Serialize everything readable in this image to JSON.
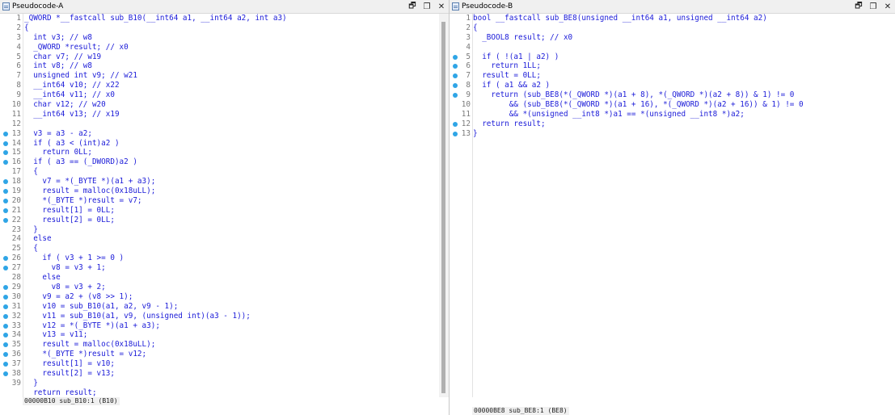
{
  "paneA": {
    "title": "Pseudocode-A",
    "controls": [
      "🗗",
      "🗖",
      "✕"
    ],
    "status": "00000B10 sub_B10:1 (B10)",
    "lines": [
      {
        "n": "1",
        "t": "_QWORD *__fastcall sub_B10(__int64 a1, __int64 a2, int a3)",
        "bp": false
      },
      {
        "n": "2",
        "t": "{",
        "bp": false
      },
      {
        "n": "3",
        "t": "  int v3; // w8",
        "bp": false
      },
      {
        "n": "4",
        "t": "  _QWORD *result; // x0",
        "bp": false
      },
      {
        "n": "5",
        "t": "  char v7; // w19",
        "bp": false
      },
      {
        "n": "6",
        "t": "  int v8; // w8",
        "bp": false
      },
      {
        "n": "7",
        "t": "  unsigned int v9; // w21",
        "bp": false
      },
      {
        "n": "8",
        "t": "  __int64 v10; // x22",
        "bp": false
      },
      {
        "n": "9",
        "t": "  __int64 v11; // x0",
        "bp": false
      },
      {
        "n": "10",
        "t": "  char v12; // w20",
        "bp": false
      },
      {
        "n": "11",
        "t": "  __int64 v13; // x19",
        "bp": false
      },
      {
        "n": "12",
        "t": "",
        "bp": false
      },
      {
        "n": "13",
        "t": "  v3 = a3 - a2;",
        "bp": true
      },
      {
        "n": "14",
        "t": "  if ( a3 < (int)a2 )",
        "bp": true
      },
      {
        "n": "15",
        "t": "    return 0LL;",
        "bp": true
      },
      {
        "n": "16",
        "t": "  if ( a3 == (_DWORD)a2 )",
        "bp": true
      },
      {
        "n": "17",
        "t": "  {",
        "bp": false
      },
      {
        "n": "18",
        "t": "    v7 = *(_BYTE *)(a1 + a3);",
        "bp": true
      },
      {
        "n": "19",
        "t": "    result = malloc(0x18uLL);",
        "bp": true
      },
      {
        "n": "20",
        "t": "    *(_BYTE *)result = v7;",
        "bp": true
      },
      {
        "n": "21",
        "t": "    result[1] = 0LL;",
        "bp": true
      },
      {
        "n": "22",
        "t": "    result[2] = 0LL;",
        "bp": true
      },
      {
        "n": "23",
        "t": "  }",
        "bp": false
      },
      {
        "n": "24",
        "t": "  else",
        "bp": false
      },
      {
        "n": "25",
        "t": "  {",
        "bp": false
      },
      {
        "n": "26",
        "t": "    if ( v3 + 1 >= 0 )",
        "bp": true
      },
      {
        "n": "27",
        "t": "      v8 = v3 + 1;",
        "bp": true
      },
      {
        "n": "28",
        "t": "    else",
        "bp": false
      },
      {
        "n": "29",
        "t": "      v8 = v3 + 2;",
        "bp": true
      },
      {
        "n": "30",
        "t": "    v9 = a2 + (v8 >> 1);",
        "bp": true
      },
      {
        "n": "31",
        "t": "    v10 = sub_B10(a1, a2, v9 - 1);",
        "bp": true
      },
      {
        "n": "32",
        "t": "    v11 = sub_B10(a1, v9, (unsigned int)(a3 - 1));",
        "bp": true
      },
      {
        "n": "33",
        "t": "    v12 = *(_BYTE *)(a1 + a3);",
        "bp": true
      },
      {
        "n": "34",
        "t": "    v13 = v11;",
        "bp": true
      },
      {
        "n": "35",
        "t": "    result = malloc(0x18uLL);",
        "bp": true
      },
      {
        "n": "36",
        "t": "    *(_BYTE *)result = v12;",
        "bp": true
      },
      {
        "n": "37",
        "t": "    result[1] = v10;",
        "bp": true
      },
      {
        "n": "38",
        "t": "    result[2] = v13;",
        "bp": true
      },
      {
        "n": "39",
        "t": "  }",
        "bp": false
      },
      {
        "n": "",
        "t": "  return result;",
        "bp": false
      }
    ]
  },
  "paneB": {
    "title": "Pseudocode-B",
    "controls": [
      "🗗",
      "🗖",
      "✕"
    ],
    "status": "00000BE8 sub_BE8:1 (BE8)",
    "lines": [
      {
        "n": "1",
        "t": "bool __fastcall sub_BE8(unsigned __int64 a1, unsigned __int64 a2)",
        "bp": false
      },
      {
        "n": "2",
        "t": "{",
        "bp": false
      },
      {
        "n": "3",
        "t": "  _BOOL8 result; // x0",
        "bp": false
      },
      {
        "n": "4",
        "t": "",
        "bp": false
      },
      {
        "n": "5",
        "t": "  if ( !(a1 | a2) )",
        "bp": true
      },
      {
        "n": "6",
        "t": "    return 1LL;",
        "bp": true
      },
      {
        "n": "7",
        "t": "  result = 0LL;",
        "bp": true
      },
      {
        "n": "8",
        "t": "  if ( a1 && a2 )",
        "bp": true
      },
      {
        "n": "9",
        "t": "    return (sub_BE8(*(_QWORD *)(a1 + 8), *(_QWORD *)(a2 + 8)) & 1) != 0",
        "bp": true
      },
      {
        "n": "10",
        "t": "        && (sub_BE8(*(_QWORD *)(a1 + 16), *(_QWORD *)(a2 + 16)) & 1) != 0",
        "bp": false
      },
      {
        "n": "11",
        "t": "        && *(unsigned __int8 *)a1 == *(unsigned __int8 *)a2;",
        "bp": false
      },
      {
        "n": "12",
        "t": "  return result;",
        "bp": true
      },
      {
        "n": "13",
        "t": "}",
        "bp": true
      }
    ]
  }
}
